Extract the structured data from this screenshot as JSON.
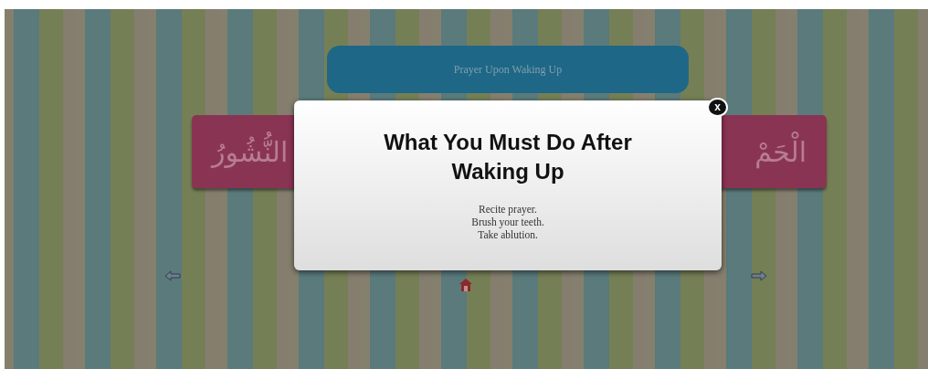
{
  "header_button": {
    "label": "Prayer Upon Waking Up"
  },
  "verse_card": {
    "right_fragment": "الْحَمْ",
    "left_fragment": "النُّشُورُ"
  },
  "modal": {
    "close_label": "x",
    "title": "What You Must Do After Waking Up",
    "lines": [
      "Recite prayer.",
      "Brush your teeth.",
      "Take ablution."
    ]
  }
}
